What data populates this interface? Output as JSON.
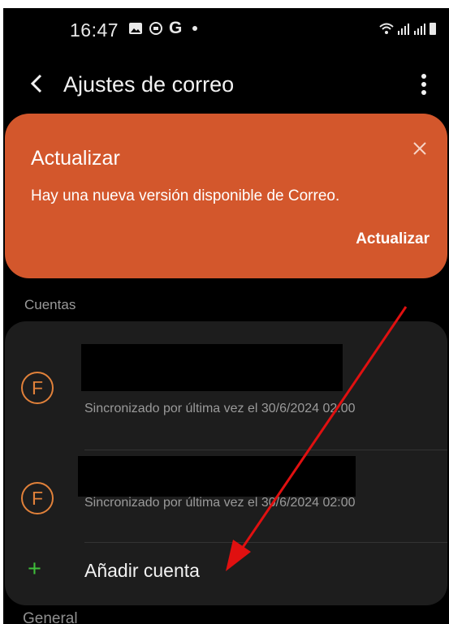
{
  "status_bar": {
    "time": "16:47",
    "g_label": "G"
  },
  "app_bar": {
    "title": "Ajustes de correo",
    "back_icon": "back-arrow-icon",
    "more_icon": "more-vert-icon"
  },
  "update_banner": {
    "title": "Actualizar",
    "message": "Hay una nueva versión disponible de Correo.",
    "action": "Actualizar",
    "color": "#d3572c"
  },
  "accounts_section": {
    "label": "Cuentas",
    "accounts": [
      {
        "avatar_letter": "F",
        "sync_text": "Sincronizado por última vez el 30/6/2024 02:00"
      },
      {
        "avatar_letter": "F",
        "sync_text": "Sincronizado por última vez el 30/6/2024 02:00"
      }
    ],
    "add_account": "Añadir cuenta"
  },
  "general_section": {
    "label": "General"
  },
  "colors": {
    "accent_orange": "#e1813a",
    "plus_green": "#3fbf3a",
    "annotation_red": "#e01010"
  }
}
